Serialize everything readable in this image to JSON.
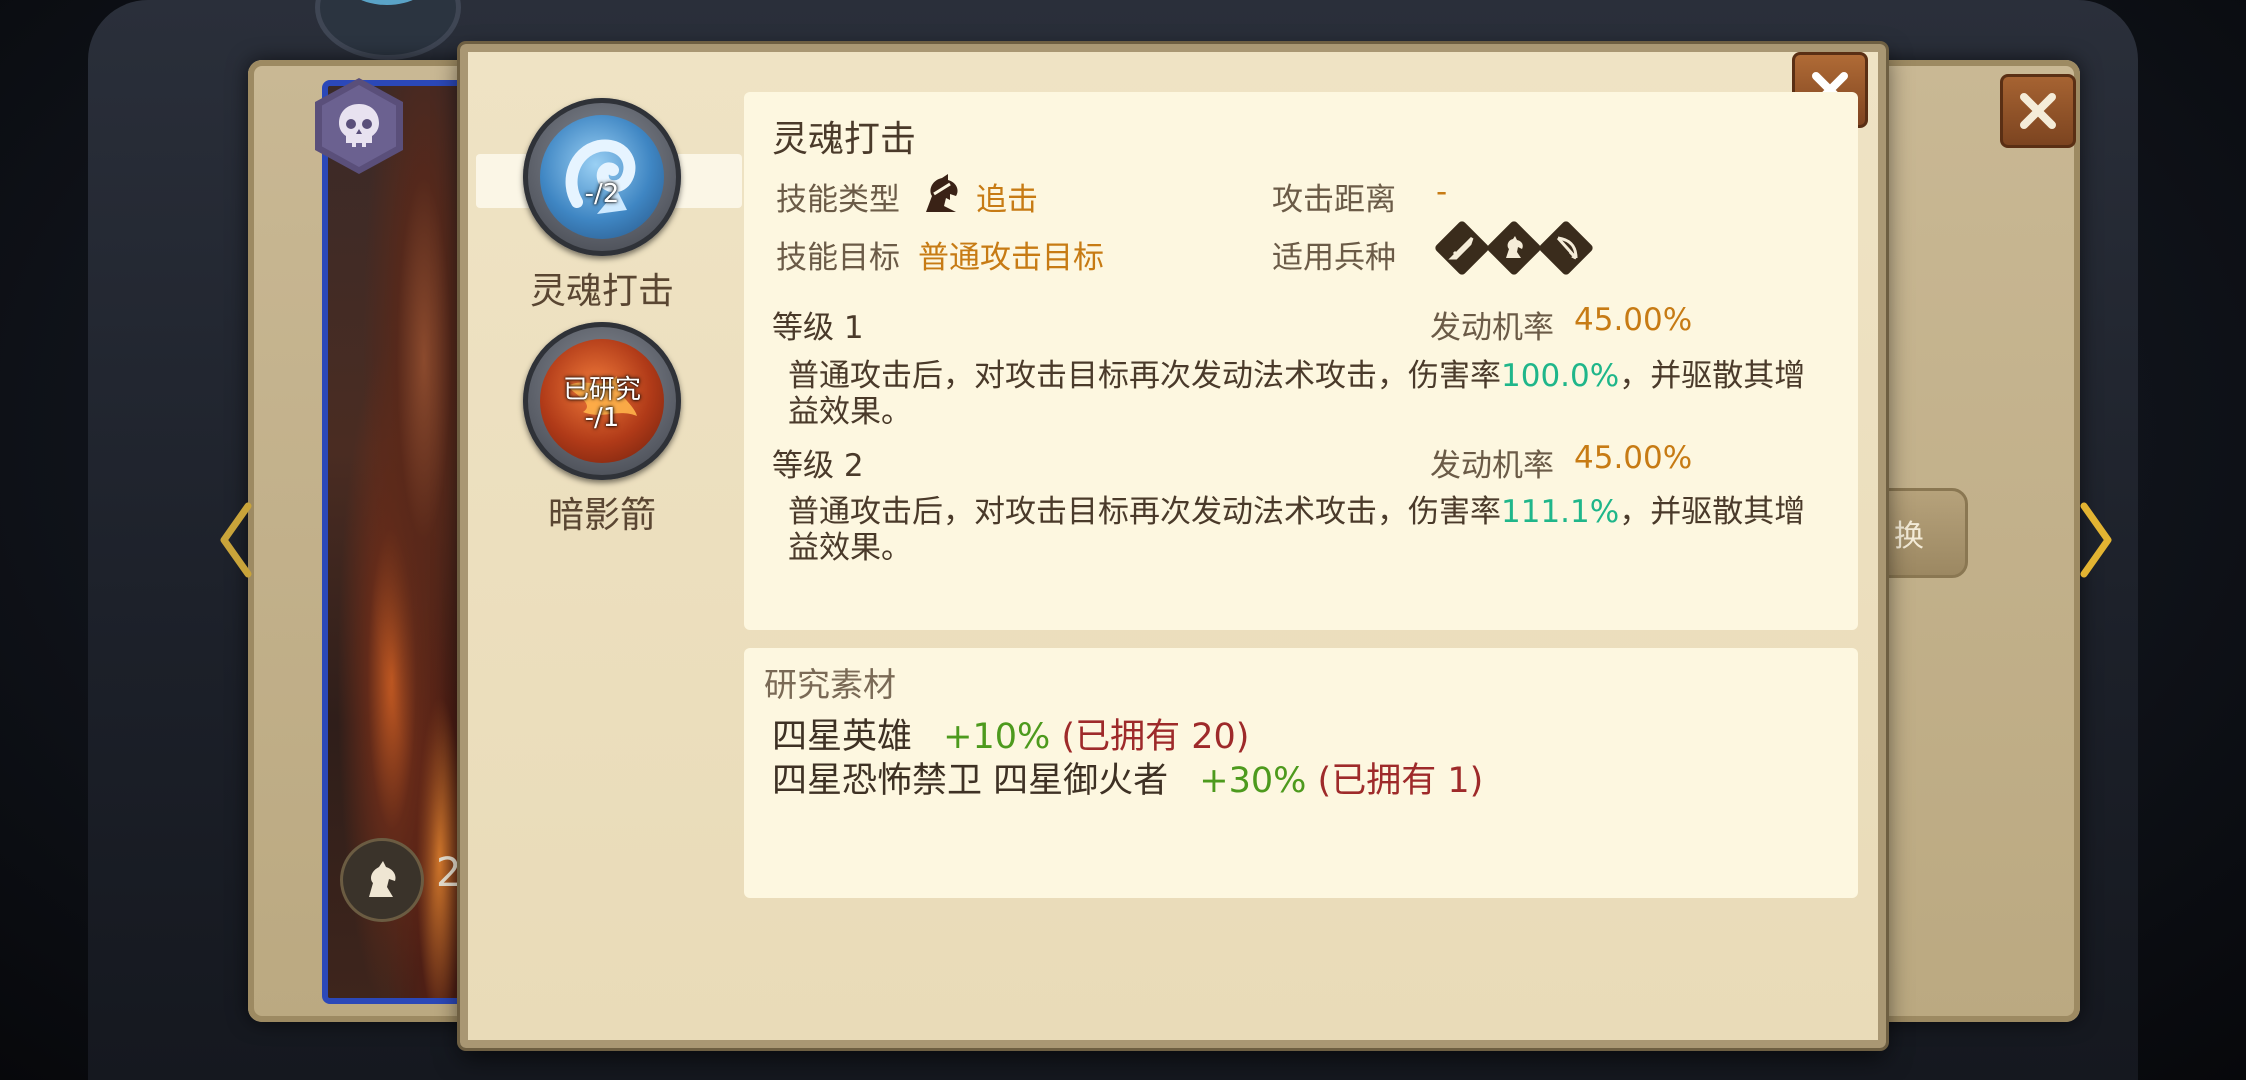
{
  "hero": {
    "level_text": "2"
  },
  "back_panel": {
    "swap_label": "换"
  },
  "skills": [
    {
      "name": "灵魂打击",
      "overlay_top": "",
      "overlay_bottom": "-/2",
      "selected": true
    },
    {
      "name": "暗影箭",
      "overlay_top": "已研究",
      "overlay_bottom": "-/1",
      "selected": false
    }
  ],
  "detail": {
    "title": "灵魂打击",
    "skill_type_label": "技能类型",
    "skill_type_value": "追击",
    "attack_range_label": "攻击距离",
    "attack_range_value": "-",
    "skill_target_label": "技能目标",
    "skill_target_value": "普通攻击目标",
    "unit_type_label": "适用兵种",
    "unit_icons": [
      "sword-icon",
      "horse-icon",
      "bow-icon"
    ],
    "levels": [
      {
        "label": "等级 1",
        "chance_label": "发动机率",
        "chance_value": "45.00%",
        "desc_before": "普通攻击后，对攻击目标再次发动法术攻击，伤害率",
        "desc_rate": "100.0%",
        "desc_after": "，并驱散其增益效果。"
      },
      {
        "label": "等级 2",
        "chance_label": "发动机率",
        "chance_value": "45.00%",
        "desc_before": "普通攻击后，对攻击目标再次发动法术攻击，伤害率",
        "desc_rate": "111.1%",
        "desc_after": "，并驱散其增益效果。"
      }
    ]
  },
  "materials": {
    "title": "研究素材",
    "rows": [
      {
        "name": "四星英雄",
        "bonus": "+10%",
        "owned": "(已拥有 20)"
      },
      {
        "name": "四星恐怖禁卫 四星御火者",
        "bonus": "+30%",
        "owned": "(已拥有 1)"
      }
    ]
  },
  "colors": {
    "accent_orange": "#c77b14",
    "rate_green": "#1fb68a",
    "bonus_green": "#4d9a1d",
    "owned_red": "#9e2a2a"
  }
}
